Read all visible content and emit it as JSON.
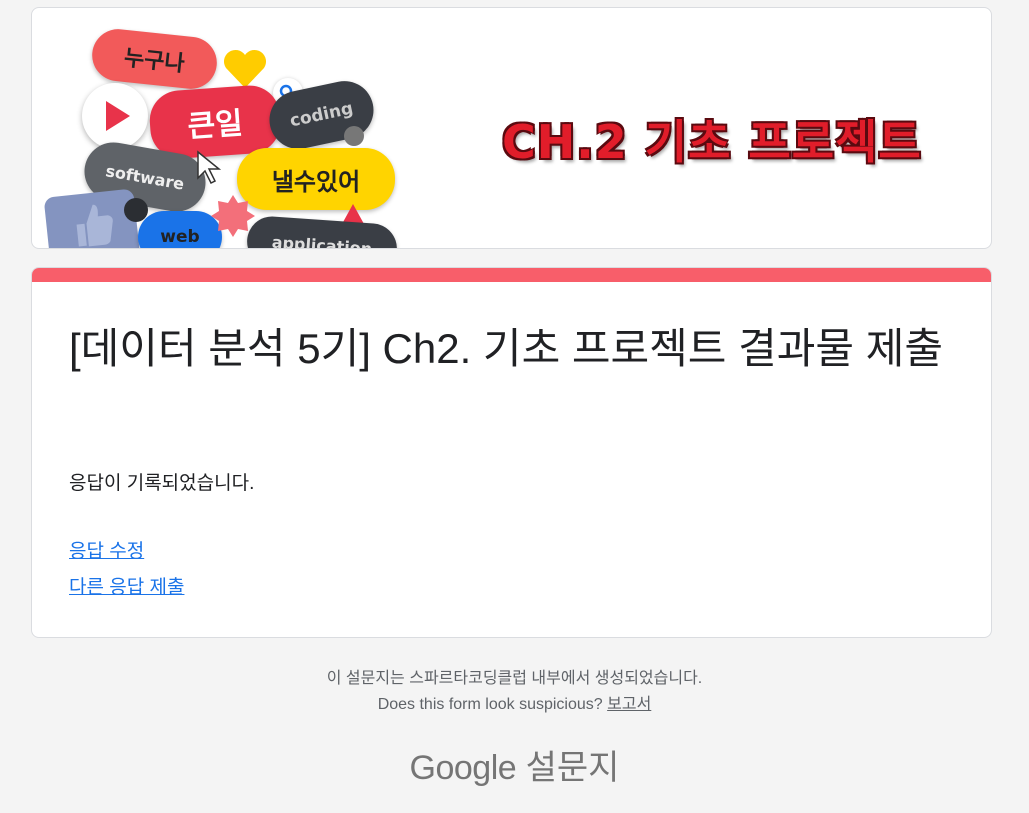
{
  "banner": {
    "title": "CH.2 기초 프로젝트",
    "collage": {
      "tag1": "누구나",
      "tag2": "큰일",
      "tag3": "낼수있어",
      "tag4": "coding",
      "tag5": "software",
      "tag6": "web",
      "tag7": "application"
    }
  },
  "form": {
    "title": "[데이터 분석 5기] Ch2. 기초 프로젝트 결과물 제출",
    "confirmation": "응답이 기록되었습니다.",
    "edit_link": "응답 수정",
    "another_link": "다른 응답 제출",
    "accent_color": "#f85e6a"
  },
  "footer": {
    "created_by": "이 설문지는 스파르타코딩클럽 내부에서 생성되었습니다.",
    "suspicious_prompt": "Does this form look suspicious?",
    "report_link": "보고서",
    "brand_google": "Google",
    "brand_forms": "설문지"
  }
}
